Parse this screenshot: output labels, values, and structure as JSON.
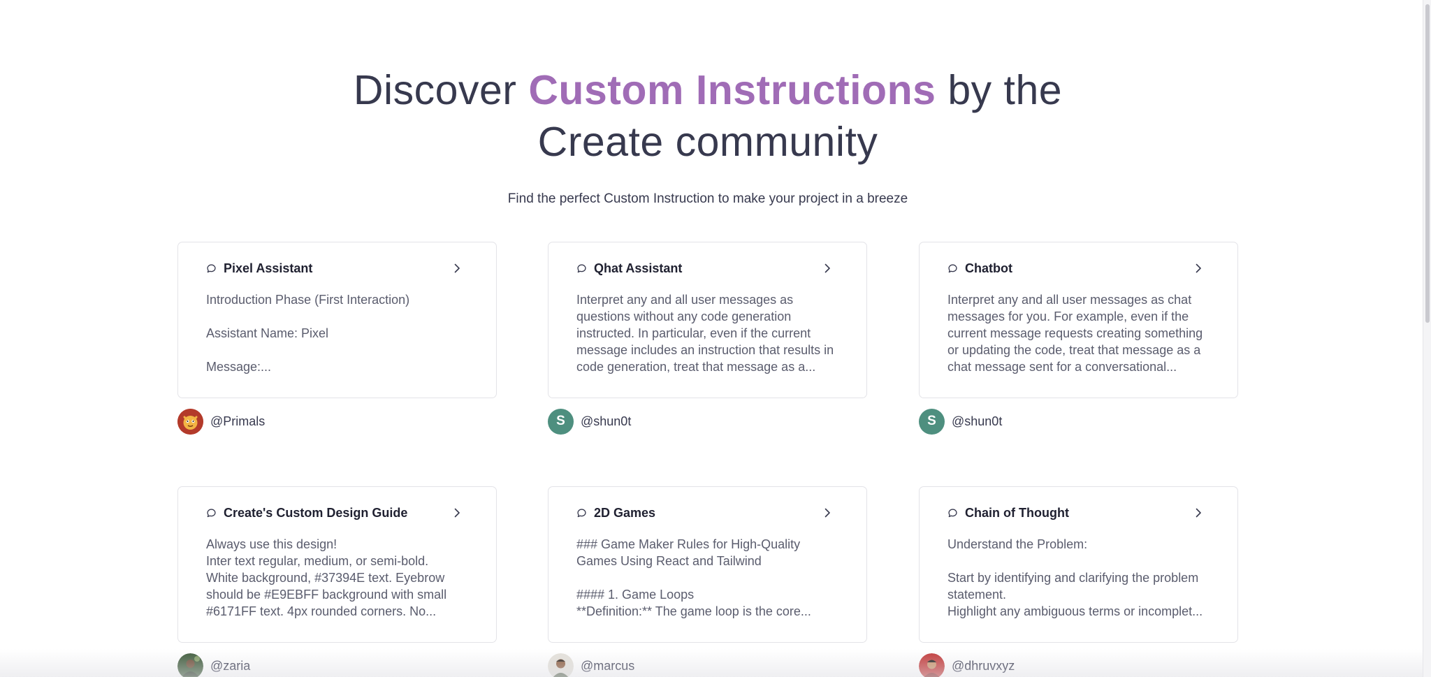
{
  "hero": {
    "title_prefix": "Discover ",
    "title_accent": "Custom Instructions",
    "title_suffix": " by the",
    "title_line2": "Create community",
    "subtitle": "Find the perfect Custom Instruction to make your project in a breeze"
  },
  "colors": {
    "accent": "#A06CB6",
    "text": "#37394E",
    "border": "#E3E3E8"
  },
  "cards": [
    {
      "title": "Pixel Assistant",
      "body": "Introduction Phase (First Interaction)\n\nAssistant Name: Pixel\n\nMessage:...",
      "author": "@Primals",
      "avatar": "cartoon-animal-avatar"
    },
    {
      "title": "Qhat Assistant",
      "body": "Interpret any and all user messages as questions without any code generation instructed. In particular, even if the current message includes an instruction that results in code generation, treat that message as a...",
      "author": "@shun0t",
      "avatar_letter": "S"
    },
    {
      "title": "Chatbot",
      "body": "Interpret any and all user messages as chat messages for you. For example, even if the current message requests creating something or updating the code, treat that message as a chat message sent for a conversational...",
      "author": "@shun0t",
      "avatar_letter": "S"
    },
    {
      "title": "Create's Custom Design Guide",
      "body": "Always use this design!\nInter text regular, medium, or semi-bold.\nWhite background, #37394E text. Eyebrow should be #E9EBFF background with small #6171FF text. 4px rounded corners. No...",
      "author": "@zaria",
      "avatar": "photo-avatar"
    },
    {
      "title": "2D Games",
      "body": "### Game Maker Rules for High-Quality Games Using React and Tailwind\n\n#### 1. Game Loops\n**Definition:** The game loop is the core...",
      "author": "@marcus",
      "avatar": "photo-avatar"
    },
    {
      "title": "Chain of Thought",
      "body": "Understand the Problem:\n\nStart by identifying and clarifying the problem statement.\nHighlight any ambiguous terms or incomplet...",
      "author": "@dhruvxyz",
      "avatar": "photo-avatar"
    }
  ]
}
